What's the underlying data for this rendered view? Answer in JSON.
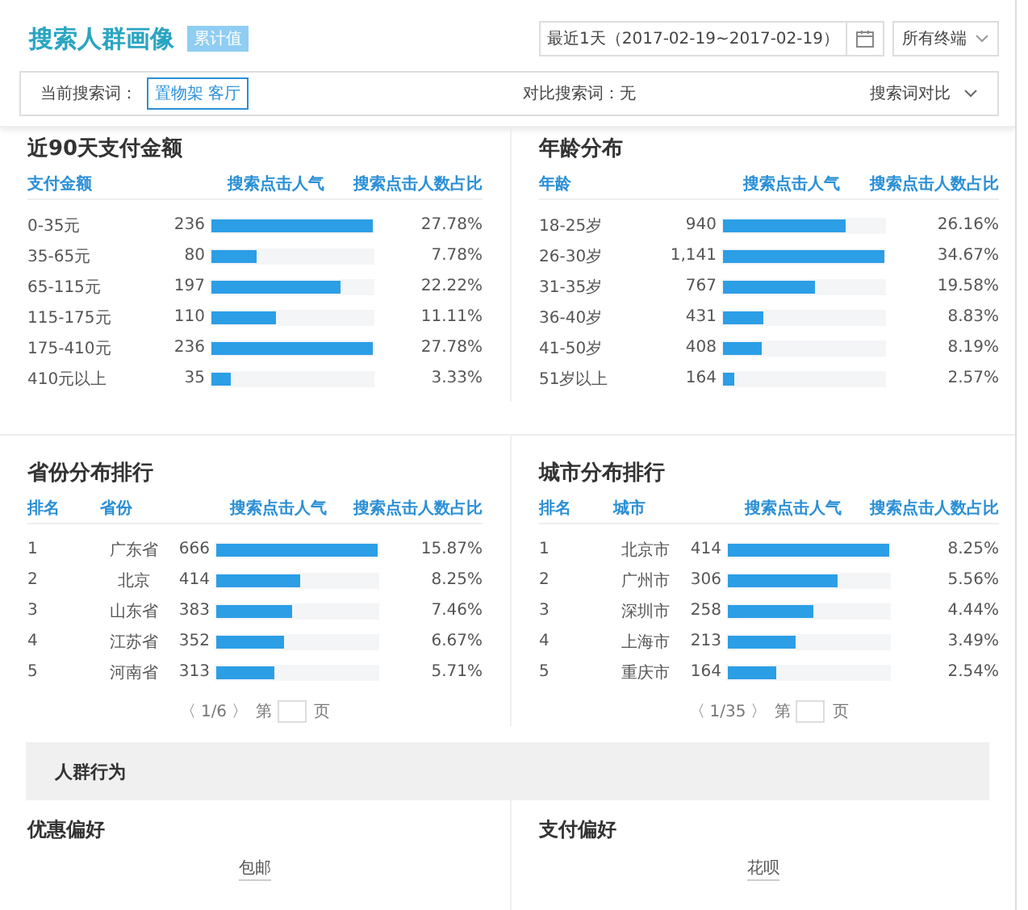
{
  "header": {
    "title": "搜索人群画像",
    "badge": "累计值",
    "date_range": "最近1天（2017-02-19~2017-02-19）",
    "terminal": "所有终端"
  },
  "filter_bar": {
    "current_label": "当前搜索词：",
    "current_term": "置物架 客厅",
    "compare_label": "对比搜索词：无",
    "compare_toggle": "搜索词对比"
  },
  "panels": [
    {
      "title": "近90天支付金额",
      "columns": [
        "支付金额",
        "搜索点击人气",
        "搜索点击人数占比"
      ],
      "rows": [
        {
          "name": "0-35元",
          "clicks": "236",
          "level": 1,
          "share": "27.78%"
        },
        {
          "name": "35-65元",
          "clicks": "80",
          "level": 0.28,
          "share": "7.78%"
        },
        {
          "name": "65-115元",
          "clicks": "197",
          "level": 0.8,
          "share": "22.22%"
        },
        {
          "name": "115-175元",
          "clicks": "110",
          "level": 0.4,
          "share": "11.11%"
        },
        {
          "name": "175-410元",
          "clicks": "236",
          "level": 1,
          "share": "27.78%"
        },
        {
          "name": "410元以上",
          "clicks": "35",
          "level": 0.12,
          "share": "3.33%"
        }
      ]
    },
    {
      "title": "年龄分布",
      "columns": [
        "年龄",
        "搜索点击人气",
        "搜索点击人数占比"
      ],
      "rows": [
        {
          "name": "18-25岁",
          "clicks": "940",
          "level": 0.76,
          "share": "26.16%"
        },
        {
          "name": "26-30岁",
          "clicks": "1,141",
          "level": 1,
          "share": "34.67%"
        },
        {
          "name": "31-35岁",
          "clicks": "767",
          "level": 0.57,
          "share": "19.58%"
        },
        {
          "name": "36-40岁",
          "clicks": "431",
          "level": 0.25,
          "share": "8.83%"
        },
        {
          "name": "41-50岁",
          "clicks": "408",
          "level": 0.24,
          "share": "8.19%"
        },
        {
          "name": "51岁以上",
          "clicks": "164",
          "level": 0.07,
          "share": "2.57%"
        }
      ]
    },
    {
      "title": "省份分布排行",
      "columns": [
        "排名",
        "省份",
        "搜索点击人气",
        "搜索点击人数占比"
      ],
      "rows": [
        {
          "rank": "1",
          "name": "广东省",
          "clicks": "666",
          "level": 1,
          "share": "15.87%"
        },
        {
          "rank": "2",
          "name": "北京",
          "clicks": "414",
          "level": 0.52,
          "share": "8.25%"
        },
        {
          "rank": "3",
          "name": "山东省",
          "clicks": "383",
          "level": 0.47,
          "share": "7.46%"
        },
        {
          "rank": "4",
          "name": "江苏省",
          "clicks": "352",
          "level": 0.42,
          "share": "6.67%"
        },
        {
          "rank": "5",
          "name": "河南省",
          "clicks": "313",
          "level": 0.36,
          "share": "5.71%"
        }
      ],
      "pager": {
        "prev": "〈",
        "page": "1/6",
        "next": "〉",
        "prefix": "第",
        "suffix": "页"
      }
    },
    {
      "title": "城市分布排行",
      "columns": [
        "排名",
        "城市",
        "搜索点击人气",
        "搜索点击人数占比"
      ],
      "rows": [
        {
          "rank": "1",
          "name": "北京市",
          "clicks": "414",
          "level": 1,
          "share": "8.25%"
        },
        {
          "rank": "2",
          "name": "广州市",
          "clicks": "306",
          "level": 0.68,
          "share": "5.56%"
        },
        {
          "rank": "3",
          "name": "深圳市",
          "clicks": "258",
          "level": 0.53,
          "share": "4.44%"
        },
        {
          "rank": "4",
          "name": "上海市",
          "clicks": "213",
          "level": 0.42,
          "share": "3.49%"
        },
        {
          "rank": "5",
          "name": "重庆市",
          "clicks": "164",
          "level": 0.3,
          "share": "2.54%"
        }
      ],
      "pager": {
        "prev": "〈",
        "page": "1/35",
        "next": "〉",
        "prefix": "第",
        "suffix": "页"
      }
    }
  ],
  "behavior": {
    "title": "人群行为",
    "panels": [
      {
        "title": "优惠偏好",
        "label": "包邮"
      },
      {
        "title": "支付偏好",
        "label": "花呗"
      }
    ]
  }
}
